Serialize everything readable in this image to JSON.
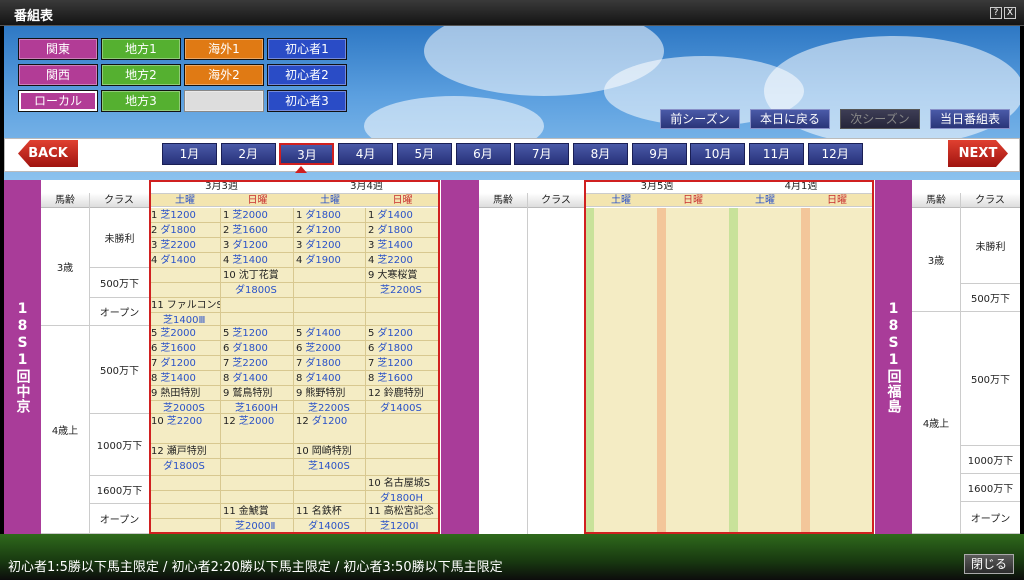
{
  "window": {
    "title": "番組表",
    "help": "?",
    "close": "X"
  },
  "areas": [
    {
      "label": "関東",
      "cls": "c-kanto"
    },
    {
      "label": "地方1",
      "cls": "c-chiho"
    },
    {
      "label": "海外1",
      "cls": "c-kaigai"
    },
    {
      "label": "初心者1",
      "cls": "c-shoshin"
    },
    {
      "label": "関西",
      "cls": "c-kanto"
    },
    {
      "label": "地方2",
      "cls": "c-chiho"
    },
    {
      "label": "海外2",
      "cls": "c-kaigai"
    },
    {
      "label": "初心者2",
      "cls": "c-shoshin"
    },
    {
      "label": "ローカル",
      "cls": "c-kanto c-sel"
    },
    {
      "label": "地方3",
      "cls": "c-chiho"
    },
    {
      "label": "",
      "cls": "c-empty"
    },
    {
      "label": "初心者3",
      "cls": "c-shoshin"
    }
  ],
  "season": {
    "prev": "前シーズン",
    "today": "本日に戻る",
    "next": "次シーズン",
    "today_program": "当日番組表"
  },
  "nav": {
    "back": "BACK",
    "next": "NEXT"
  },
  "months": [
    "1月",
    "2月",
    "3月",
    "4月",
    "5月",
    "6月",
    "7月",
    "8月",
    "9月",
    "10月",
    "11月",
    "12月"
  ],
  "selected_month": "3月",
  "left_meet": "18S1回中京",
  "right_meet": "18S1回福島",
  "headers": {
    "age": "馬齢",
    "class": "クラス"
  },
  "left_weeks": [
    "3月3週",
    "3月4週"
  ],
  "right_weeks": [
    "3月5週",
    "4月1週"
  ],
  "days": {
    "sat": "土曜",
    "sun": "日曜"
  },
  "ages": {
    "three": "3歳",
    "four_up": "4歳上"
  },
  "classes": {
    "maiden": "未勝利",
    "c500": "500万下",
    "open": "オープン",
    "c1000": "1000万下",
    "c1600": "1600万下"
  },
  "races": [
    [
      "1",
      "芝1200",
      "1",
      "芝2000",
      "1",
      "ダ1800",
      "1",
      "ダ1400"
    ],
    [
      "2",
      "ダ1800",
      "2",
      "芝1600",
      "2",
      "ダ1200",
      "2",
      "ダ1800"
    ],
    [
      "3",
      "芝2200",
      "3",
      "ダ1200",
      "3",
      "ダ1200",
      "3",
      "芝1400"
    ],
    [
      "4",
      "ダ1400",
      "4",
      "芝1400",
      "4",
      "ダ1900",
      "4",
      "芝2200"
    ],
    [
      "",
      "",
      "10",
      "沈丁花賞",
      "",
      "",
      "9",
      "大寒桜賞"
    ],
    [
      "",
      "",
      "",
      "ダ1800S",
      "",
      "",
      "",
      "芝2200S"
    ],
    [
      "11",
      "ファルコンS",
      "",
      "",
      "",
      "",
      "",
      ""
    ],
    [
      "",
      "芝1400Ⅲ",
      "",
      "",
      "",
      "",
      "",
      ""
    ],
    [
      "5",
      "芝2000",
      "5",
      "芝1200",
      "5",
      "ダ1400",
      "5",
      "ダ1200"
    ],
    [
      "6",
      "芝1600",
      "6",
      "ダ1800",
      "6",
      "芝2000",
      "6",
      "ダ1800"
    ],
    [
      "7",
      "ダ1200",
      "7",
      "芝2200",
      "7",
      "ダ1800",
      "7",
      "芝1200"
    ],
    [
      "8",
      "芝1400",
      "8",
      "ダ1400",
      "8",
      "ダ1400",
      "8",
      "芝1600"
    ],
    [
      "9",
      "熱田特別",
      "9",
      "鷲鳥特別",
      "9",
      "熊野特別",
      "12",
      "鈴鹿特別"
    ],
    [
      "",
      "芝2000S",
      "",
      "芝1600H",
      "",
      "芝2200S",
      "",
      "ダ1400S"
    ],
    [
      "10",
      "芝2200",
      "12",
      "芝2000",
      "12",
      "ダ1200",
      "",
      ""
    ],
    [
      "12",
      "瀬戸特別",
      "",
      "",
      "10",
      "岡崎特別",
      "",
      ""
    ],
    [
      "",
      "ダ1800S",
      "",
      "",
      "",
      "芝1400S",
      "",
      ""
    ],
    [
      "",
      "",
      "",
      "",
      "",
      "",
      "10",
      "名古屋城S"
    ],
    [
      "",
      "",
      "",
      "",
      "",
      "",
      "",
      "ダ1800H"
    ],
    [
      "",
      "",
      "11",
      "金鯱賞",
      "11",
      "名鉄杯",
      "11",
      "高松宮記念"
    ],
    [
      "",
      "",
      "",
      "芝2000Ⅱ",
      "",
      "ダ1400S",
      "",
      "芝1200Ⅰ"
    ]
  ],
  "footer": {
    "text": "初心者1:5勝以下馬主限定 / 初心者2:20勝以下馬主限定 / 初心者3:50勝以下馬主限定",
    "close": "閉じる"
  }
}
